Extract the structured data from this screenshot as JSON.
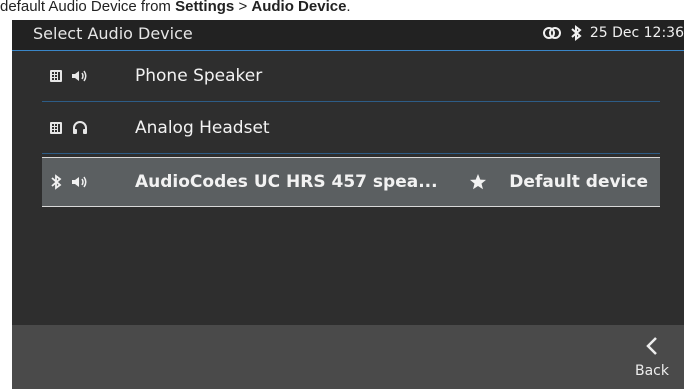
{
  "doc_caption": {
    "prefix": "default Audio Device from ",
    "path_a": "Settings",
    "sep": " > ",
    "path_b": "Audio Device",
    "suffix": "."
  },
  "status_bar": {
    "title": "Select Audio Device",
    "datetime": "25 Dec 12:36",
    "icons": [
      "link-icon",
      "bluetooth-icon"
    ]
  },
  "devices": [
    {
      "label": "Phone Speaker",
      "source_icon": "phone-icon",
      "kind_icon": "speaker-icon",
      "selected": false
    },
    {
      "label": "Analog Headset",
      "source_icon": "phone-icon",
      "kind_icon": "headset-icon",
      "selected": false
    },
    {
      "label": "AudioCodes UC HRS 457 spea...",
      "source_icon": "bluetooth-icon",
      "kind_icon": "speaker-icon",
      "selected": true,
      "default_icon": "star-icon",
      "default_label": "Default device"
    }
  ],
  "softkeys": {
    "back_label": "Back",
    "back_icon": "chevron-left-icon"
  },
  "colors": {
    "status_bar_bg": "#222222",
    "screen_bg": "#2e2e2e",
    "accent_line": "#3a86c8",
    "selected_bg": "#5b5f61",
    "softkey_bg": "#4a4a4a"
  }
}
